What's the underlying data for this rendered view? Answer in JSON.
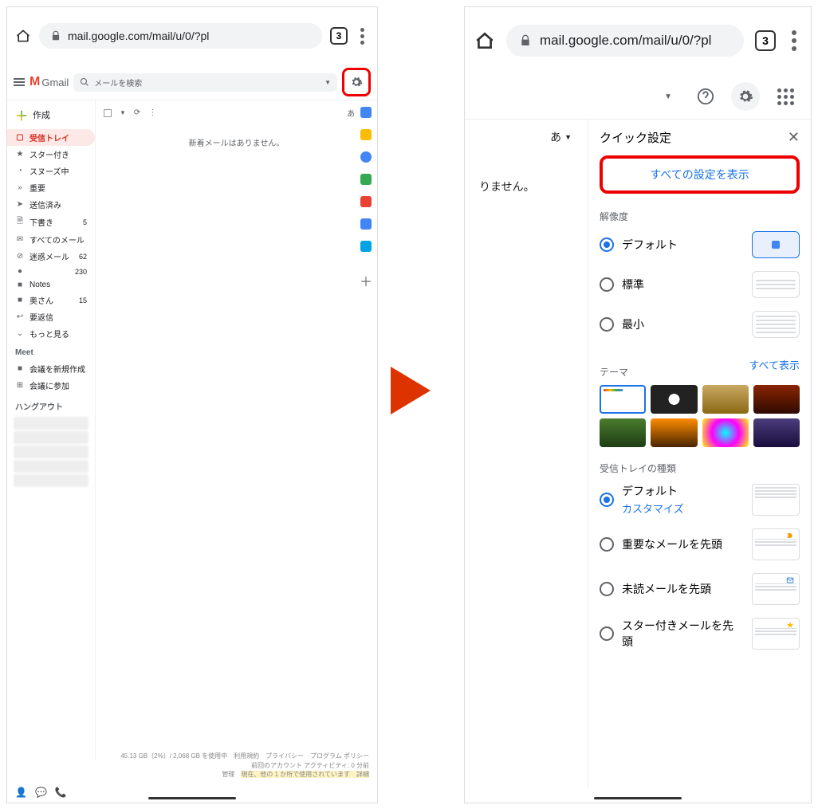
{
  "url": "mail.google.com/mail/u/0/?pl",
  "tabCount": "3",
  "gmail": {
    "brand": "Gmail",
    "searchPlaceholder": "メールを検索",
    "composeLabel": "作成",
    "langIndicator": "あ",
    "emptyMessage": "新着メールはありません。",
    "nav": [
      {
        "icon": "▢",
        "label": "受信トレイ",
        "active": true
      },
      {
        "icon": "★",
        "label": "スター付き"
      },
      {
        "icon": "◔",
        "label": "スヌーズ中"
      },
      {
        "icon": "»",
        "label": "重要"
      },
      {
        "icon": "➤",
        "label": "送信済み"
      },
      {
        "icon": "🗎",
        "label": "下書き",
        "count": "5"
      },
      {
        "icon": "✉",
        "label": "すべてのメール"
      },
      {
        "icon": "⊘",
        "label": "迷惑メール",
        "count": "62"
      },
      {
        "icon": "●",
        "label": "",
        "count": "230"
      },
      {
        "icon": "■",
        "label": "Notes"
      },
      {
        "icon": "■",
        "label": "奥さん",
        "count": "15"
      },
      {
        "icon": "↩",
        "label": "要返信"
      },
      {
        "icon": "⌄",
        "label": "もっと見る"
      }
    ],
    "meet": {
      "title": "Meet",
      "new": "会議を新規作成",
      "join": "会議に参加"
    },
    "hangout": {
      "title": "ハングアウト"
    },
    "footer": {
      "storage": "45.13 GB（2%）/ 2,068 GB を使用中",
      "links": "利用規約　プライバシー　プログラム ポリシー　前回のアカウント アクティビティ: 0 分前",
      "manage": "管理",
      "session": "現在、他の 1 か所で使用されています　詳細"
    }
  },
  "rightContent": {
    "partial": "りません。"
  },
  "quickSettings": {
    "title": "クイック設定",
    "allSettings": "すべての設定を表示",
    "density": {
      "title": "解像度",
      "options": [
        "デフォルト",
        "標準",
        "最小"
      ]
    },
    "theme": {
      "title": "テーマ",
      "all": "すべて表示"
    },
    "inboxType": {
      "title": "受信トレイの種類",
      "options": [
        {
          "label": "デフォルト",
          "sub": "カスタマイズ"
        },
        {
          "label": "重要なメールを先頭"
        },
        {
          "label": "未読メールを先頭"
        },
        {
          "label": "スター付きメールを先頭"
        }
      ]
    }
  }
}
